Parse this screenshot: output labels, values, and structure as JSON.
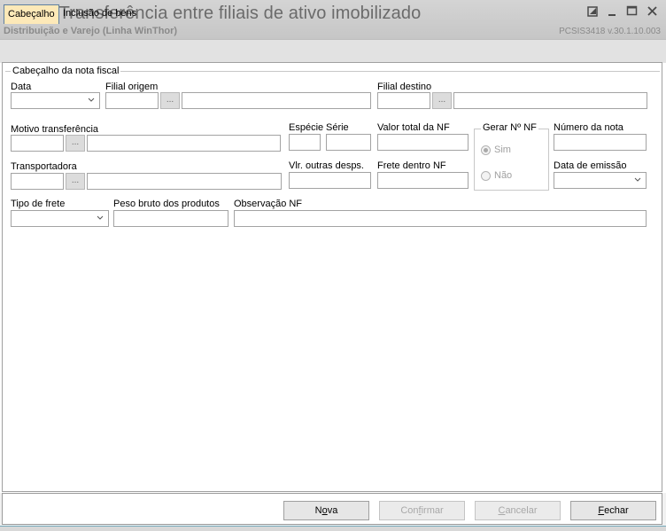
{
  "window": {
    "title": "3418 - Transferência entre filiais de ativo imobilizado",
    "subtitle": "Distribuição e Varejo (Linha WinThor)",
    "code": "PCSIS3418  v.30.1.10.003"
  },
  "tabs": [
    {
      "label": "Cabeçalho",
      "active": true
    },
    {
      "label": "Inclusão de bens",
      "active": false
    }
  ],
  "section": {
    "legend": "Cabeçalho da nota fiscal"
  },
  "labels": {
    "data": "Data",
    "filial_origem": "Filial origem",
    "filial_destino": "Filial destino",
    "motivo": "Motivo transferência",
    "especie": "Espécie",
    "serie": "Série",
    "valor_total": "Valor total da NF",
    "gerar_nf": "Gerar Nº NF",
    "numero_nota": "Número da nota",
    "transportadora": "Transportadora",
    "vlr_outras": "Vlr. outras desps.",
    "frete_dentro": "Frete dentro NF",
    "data_emissao": "Data de emissão",
    "tipo_frete": "Tipo de frete",
    "peso_bruto": "Peso bruto dos produtos",
    "observacao": "Observação NF"
  },
  "radio": {
    "sim": "Sim",
    "nao": "Não"
  },
  "ellipsis": "...",
  "buttons": {
    "nova_pre": "N",
    "nova_ul": "o",
    "nova_post": "va",
    "confirmar_pre": "Con",
    "confirmar_ul": "f",
    "confirmar_post": "irmar",
    "cancelar_pre": "",
    "cancelar_ul": "C",
    "cancelar_post": "ancelar",
    "fechar_pre": "",
    "fechar_ul": "F",
    "fechar_post": "echar"
  },
  "colors": {
    "active_tab": "#fde9b8",
    "title_text": "#6b6b6b"
  }
}
